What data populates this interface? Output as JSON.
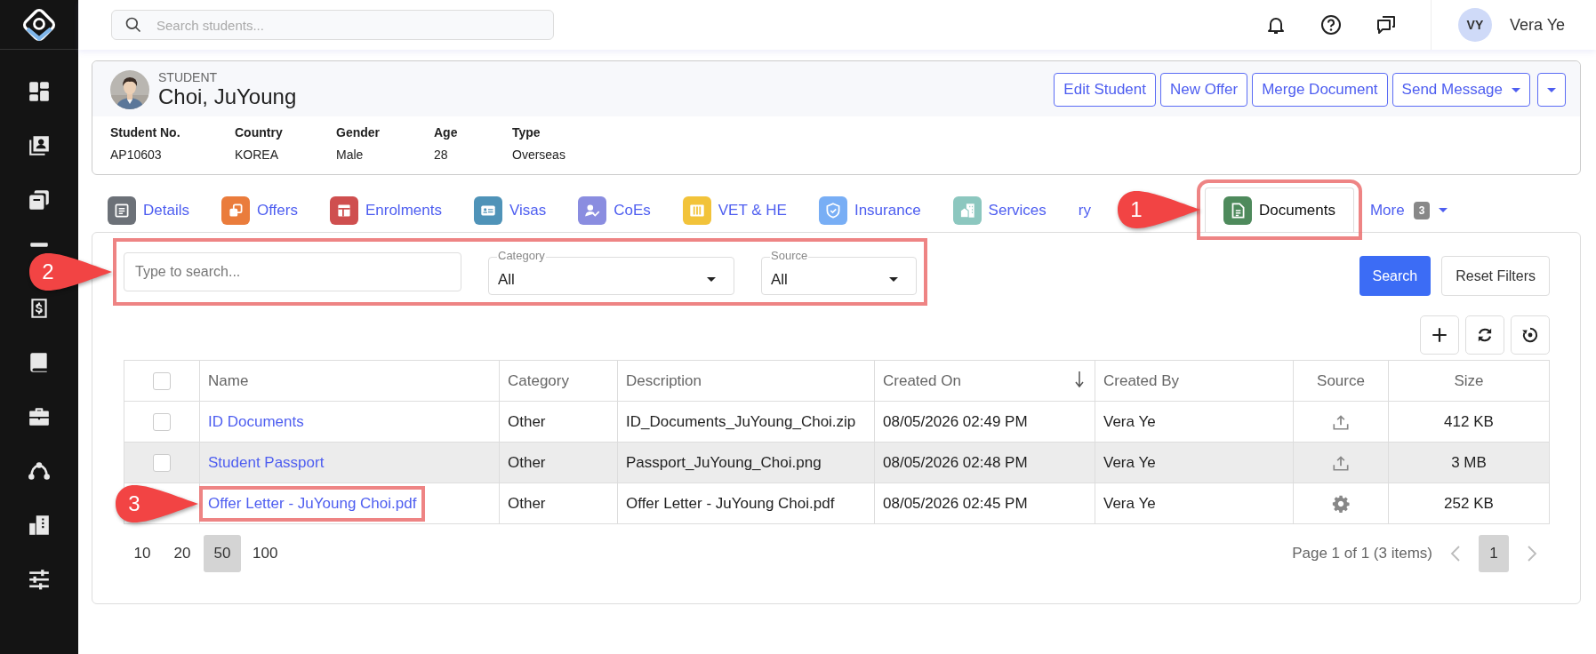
{
  "topbar": {
    "search": {
      "placeholder": "Search students..."
    },
    "user": {
      "initials": "VY",
      "name": "Vera Ye"
    }
  },
  "student": {
    "label": "STUDENT",
    "name": "Choi, JuYoung",
    "actions": [
      {
        "kind": "button",
        "label": "Edit Student"
      },
      {
        "kind": "button",
        "label": "New Offer"
      },
      {
        "kind": "button",
        "label": "Merge Document"
      },
      {
        "kind": "dropdown",
        "label": "Send Message"
      },
      {
        "kind": "caret"
      }
    ],
    "fields": [
      {
        "label": "Student No.",
        "value": "AP10603"
      },
      {
        "label": "Country",
        "value": "KOREA"
      },
      {
        "label": "Gender",
        "value": "Male"
      },
      {
        "label": "Age",
        "value": "28"
      },
      {
        "label": "Type",
        "value": "Overseas"
      }
    ]
  },
  "tabs": [
    {
      "kind": "icon",
      "label": "Details",
      "color": "#6c7178",
      "selected": false
    },
    {
      "kind": "icon",
      "label": "Offers",
      "color": "#ea7c3c",
      "selected": false
    },
    {
      "kind": "icon",
      "label": "Enrolments",
      "color": "#cf4f4f",
      "selected": false
    },
    {
      "kind": "icon",
      "label": "Visas",
      "color": "#4f93b8",
      "selected": false
    },
    {
      "kind": "icon",
      "label": "CoEs",
      "color": "#8a8de0",
      "selected": false
    },
    {
      "kind": "icon",
      "label": "VET & HE",
      "color": "#f2c33a",
      "selected": false
    },
    {
      "kind": "icon",
      "label": "Insurance",
      "color": "#78aef5",
      "selected": false
    },
    {
      "kind": "icon",
      "label": "Services",
      "color": "#8cc7bf",
      "selected": false
    },
    {
      "kind": "plain",
      "label": "ry",
      "selected": false
    },
    {
      "kind": "icon",
      "label": "Documents",
      "color": "#4e8a5c",
      "selected": true,
      "callout": "1"
    },
    {
      "kind": "more",
      "label": "More",
      "badge": "3",
      "selected": false
    }
  ],
  "filters": {
    "callout": "2",
    "search": {
      "placeholder": "Type to search..."
    },
    "selects": [
      {
        "label": "Category",
        "value": "All"
      },
      {
        "label": "Source",
        "value": "All"
      }
    ],
    "buttons": [
      {
        "kind": "primary",
        "label": "Search"
      },
      {
        "kind": "default",
        "label": "Reset Filters"
      }
    ]
  },
  "table": {
    "all_checked": false,
    "columns": [
      {
        "label": "Name",
        "sorted": false
      },
      {
        "label": "Category",
        "sorted": false
      },
      {
        "label": "Description",
        "sorted": false
      },
      {
        "label": "Created On",
        "sorted": true
      },
      {
        "label": "Created By",
        "sorted": false
      },
      {
        "label": "Source",
        "sorted": false
      },
      {
        "label": "Size",
        "sorted": false
      }
    ],
    "rows": [
      {
        "kind": "upload",
        "checked": false,
        "highlighted": false,
        "name": "ID Documents",
        "category": "Other",
        "description": "ID_Documents_JuYoung_Choi.zip",
        "created_on": "08/05/2026 02:49 PM",
        "created_by": "Vera Ye",
        "size": "412 KB"
      },
      {
        "kind": "upload",
        "checked": false,
        "highlighted": true,
        "name": "Student Passport",
        "category": "Other",
        "description": "Passport_JuYoung_Choi.png",
        "created_on": "08/05/2026 02:48 PM",
        "created_by": "Vera Ye",
        "size": "3 MB"
      },
      {
        "kind": "generated",
        "highlighted": false,
        "name": "Offer Letter - JuYoung Choi.pdf",
        "callout": "3",
        "category": "Other",
        "description": "Offer Letter - JuYoung Choi.pdf",
        "created_on": "08/05/2026 02:45 PM",
        "created_by": "Vera Ye",
        "size": "252 KB"
      }
    ]
  },
  "pagination": {
    "page_sizes": [
      {
        "label": "10",
        "selected": false
      },
      {
        "label": "20",
        "selected": false
      },
      {
        "label": "50",
        "selected": true
      },
      {
        "label": "100",
        "selected": false
      }
    ],
    "summary": "Page 1 of 1 (3 items)",
    "pages": [
      {
        "label": "1",
        "selected": true
      }
    ]
  }
}
